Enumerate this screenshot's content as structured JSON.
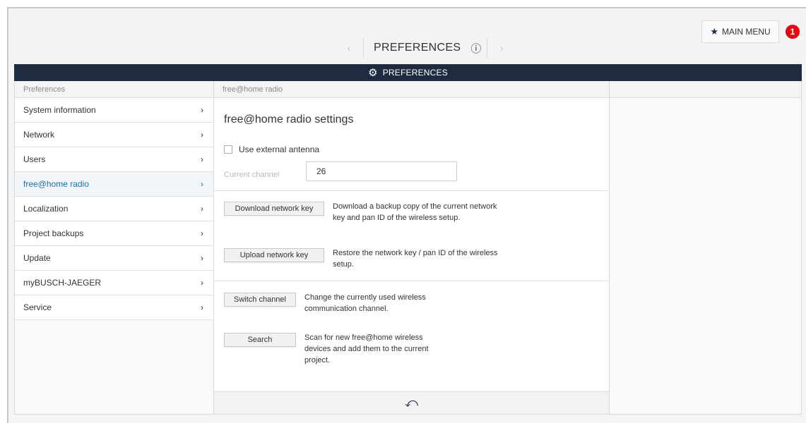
{
  "topbar": {
    "title": "PREFERENCES",
    "prev_icon": "chevron-left-icon",
    "next_icon": "chevron-right-icon",
    "help_icon": "question-circle-icon",
    "main_menu_label": "MAIN MENU",
    "notification_count": "1"
  },
  "header": {
    "label": "PREFERENCES"
  },
  "sidebar": {
    "heading": "Preferences",
    "items": [
      {
        "label": "System information"
      },
      {
        "label": "Network"
      },
      {
        "label": "Users"
      },
      {
        "label": "free@home radio"
      },
      {
        "label": "Localization"
      },
      {
        "label": "Project backups"
      },
      {
        "label": "Update"
      },
      {
        "label": "myBUSCH-JAEGER"
      },
      {
        "label": "Service"
      }
    ]
  },
  "content": {
    "heading": "free@home radio",
    "title": "free@home radio settings",
    "checkbox_label": "Use external antenna",
    "channel_label": "Current channel",
    "channel_value": "26",
    "download_label": "Download network key",
    "download_desc": "Download a backup copy of the current network key and pan ID of the wireless setup.",
    "upload_label": "Upload network key",
    "upload_desc": "Restore the network key / pan ID of the wireless setup.",
    "switch_label": "Switch channel",
    "switch_desc": "Change the currently used wireless communication channel.",
    "search_label": "Search",
    "search_desc": "Scan for new free@home wireless devices and add them to the current project."
  },
  "colors": {
    "header_bg": "#1f2b40",
    "accent": "#1c6fa8",
    "badge": "#e30613"
  }
}
